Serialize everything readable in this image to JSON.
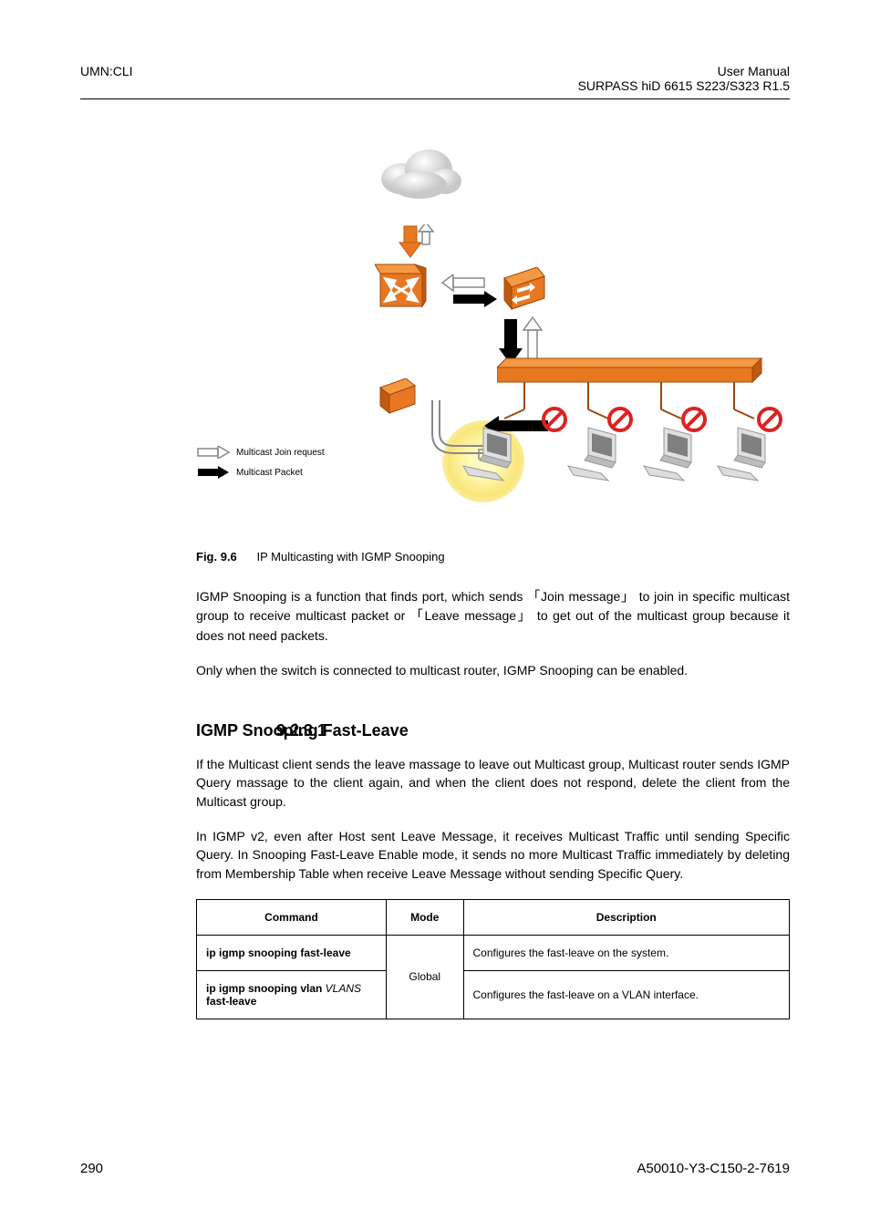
{
  "header": {
    "left": "UMN:CLI",
    "right_line1": "User Manual",
    "right_line2": "SURPASS hiD 6615 S223/S323 R1.5"
  },
  "legend": {
    "join": "Multicast Join request",
    "packet": "Multicast Packet"
  },
  "figure": {
    "prefix": "Fig. 9.6",
    "caption": "IP Multicasting with IGMP Snooping"
  },
  "para1": {
    "pre": "IGMP Snooping is a function that finds port, which sends ",
    "msg1": "Join message",
    "mid": " to join in specific multicast group to receive multicast packet or ",
    "msg2": "Leave message",
    "post": " to get out of the multicast group because it does not need packets."
  },
  "para2": "Only when the switch is connected to multicast router, IGMP Snooping can be enabled.",
  "section": {
    "num": "9.2.3.1",
    "title": "IGMP Snooping Fast-Leave"
  },
  "para3": "If the Multicast client sends the leave massage to leave out Multicast group, Multicast router sends IGMP Query massage to the client again, and when the client does not respond, delete the client from the Multicast group.",
  "para4": "In IGMP v2, even after Host sent Leave Message, it receives Multicast Traffic until sending Specific Query. In Snooping Fast-Leave Enable mode, it sends no more Multicast Traffic immediately by deleting from Membership Table when receive Leave Message without sending Specific Query.",
  "table": {
    "headers": [
      "Command",
      "Mode",
      "Description"
    ],
    "rows": [
      {
        "command": "ip igmp snooping fast-leave",
        "description": "Configures the fast-leave on the system."
      },
      {
        "command": "ip igmp snooping vlan VLANS fast-leave",
        "description": "Configures the fast-leave on a VLAN interface."
      }
    ],
    "mode": "Global"
  },
  "footer": {
    "page": "290",
    "code": "A50010-Y3-C150-2-7619"
  },
  "icons": {
    "cloud": "cloud-icon",
    "router": "router-icon",
    "switch": "switch-icon",
    "workstation": "workstation-icon",
    "prohibit": "prohibit-icon",
    "arrow_hollow": "hollow-arrow-icon",
    "arrow_solid": "solid-arrow-icon"
  }
}
